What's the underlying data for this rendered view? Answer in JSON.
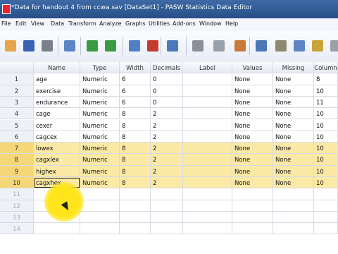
{
  "window": {
    "title": "*Data for handout 4 from ccwa.sav [DataSet1] - PASW Statistics Data Editor"
  },
  "menu": [
    "File",
    "Edit",
    "View",
    "Data",
    "Transform",
    "Analyze",
    "Graphs",
    "Utilities",
    "Add-ons",
    "Window",
    "Help"
  ],
  "toolbar": {
    "icons": [
      "open-icon",
      "save-icon",
      "print-icon",
      "dialog-recall-icon",
      "undo-icon",
      "redo-icon",
      "goto-case-icon",
      "goto-variable-icon",
      "variables-icon",
      "find-icon",
      "insert-cases-icon",
      "insert-variable-icon",
      "split-file-icon",
      "weight-cases-icon",
      "select-cases-icon",
      "value-labels-icon",
      "use-sets-icon"
    ]
  },
  "grid": {
    "columns": [
      "Name",
      "Type",
      "Width",
      "Decimals",
      "Label",
      "Values",
      "Missing",
      "Column"
    ],
    "rows": [
      {
        "n": "1",
        "cells": [
          "age",
          "Numeric",
          "6",
          "0",
          "",
          "None",
          "None",
          "8"
        ],
        "hl": false
      },
      {
        "n": "2",
        "cells": [
          "exercise",
          "Numeric",
          "6",
          "0",
          "",
          "None",
          "None",
          "10"
        ],
        "hl": false
      },
      {
        "n": "3",
        "cells": [
          "endurance",
          "Numeric",
          "6",
          "0",
          "",
          "None",
          "None",
          "11"
        ],
        "hl": false
      },
      {
        "n": "4",
        "cells": [
          "cage",
          "Numeric",
          "8",
          "2",
          "",
          "None",
          "None",
          "10"
        ],
        "hl": false
      },
      {
        "n": "5",
        "cells": [
          "cexer",
          "Numeric",
          "8",
          "2",
          "",
          "None",
          "None",
          "10"
        ],
        "hl": false
      },
      {
        "n": "6",
        "cells": [
          "cagcex",
          "Numeric",
          "8",
          "2",
          "",
          "None",
          "None",
          "10"
        ],
        "hl": false
      },
      {
        "n": "7",
        "cells": [
          "lowex",
          "Numeric",
          "8",
          "2",
          "",
          "None",
          "None",
          "10"
        ],
        "hl": true
      },
      {
        "n": "8",
        "cells": [
          "cagxlex",
          "Numeric",
          "8",
          "2",
          "",
          "None",
          "None",
          "10"
        ],
        "hl": true
      },
      {
        "n": "9",
        "cells": [
          "highex",
          "Numeric",
          "8",
          "2",
          "",
          "None",
          "None",
          "10"
        ],
        "hl": true
      },
      {
        "n": "10",
        "cells": [
          "cagxhex",
          "Numeric",
          "8",
          "2",
          "",
          "None",
          "None",
          "10"
        ],
        "hl": true
      },
      {
        "n": "11",
        "cells": [
          "",
          "",
          "",
          "",
          "",
          "",
          "",
          ""
        ],
        "hl": false
      },
      {
        "n": "12",
        "cells": [
          "",
          "",
          "",
          "",
          "",
          "",
          "",
          ""
        ],
        "hl": false
      },
      {
        "n": "13",
        "cells": [
          "",
          "",
          "",
          "",
          "",
          "",
          "",
          ""
        ],
        "hl": false
      },
      {
        "n": "14",
        "cells": [
          "",
          "",
          "",
          "",
          "",
          "",
          "",
          ""
        ],
        "hl": false
      }
    ]
  },
  "colors": {
    "highlight": "#fbe9a6",
    "titlebar": "#2f5a94"
  }
}
